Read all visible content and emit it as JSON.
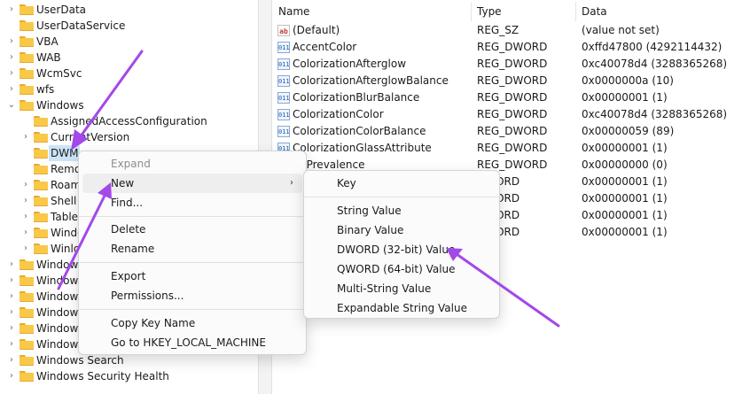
{
  "colors": {
    "accent": "#a348e9",
    "selection": "#cce4f7",
    "folder": "#f8c948"
  },
  "tree": {
    "items": [
      {
        "label": "UserData",
        "icon": "folder-icon"
      },
      {
        "label": "UserDataService",
        "icon": "folder-icon"
      },
      {
        "label": "VBA",
        "icon": "folder-icon"
      },
      {
        "label": "WAB",
        "icon": "folder-icon"
      },
      {
        "label": "WcmSvc",
        "icon": "folder-icon"
      },
      {
        "label": "wfs",
        "icon": "folder-icon"
      },
      {
        "label": "Windows",
        "icon": "folder-icon"
      },
      {
        "label": "AssignedAccessConfiguration",
        "icon": "folder-icon"
      },
      {
        "label": "CurrentVersion",
        "icon": "folder-icon"
      },
      {
        "label": "DWM",
        "icon": "folder-icon"
      },
      {
        "label": "Remo",
        "icon": "folder-icon"
      },
      {
        "label": "Roam",
        "icon": "folder-icon"
      },
      {
        "label": "Shell",
        "icon": "folder-icon"
      },
      {
        "label": "Tablet",
        "icon": "folder-icon"
      },
      {
        "label": "Windo",
        "icon": "folder-icon"
      },
      {
        "label": "Winlo",
        "icon": "folder-icon"
      },
      {
        "label": "Windows",
        "icon": "folder-icon"
      },
      {
        "label": "Windows",
        "icon": "folder-icon"
      },
      {
        "label": "Windows",
        "icon": "folder-icon"
      },
      {
        "label": "Windows",
        "icon": "folder-icon"
      },
      {
        "label": "Windows",
        "icon": "folder-icon"
      },
      {
        "label": "Windows",
        "icon": "folder-icon"
      },
      {
        "label": "Windows Search",
        "icon": "folder-icon"
      },
      {
        "label": "Windows Security Health",
        "icon": "folder-icon"
      }
    ]
  },
  "list": {
    "columns": [
      "Name",
      "Type",
      "Data"
    ],
    "rows": [
      {
        "name": "(Default)",
        "type": "REG_SZ",
        "data": "(value not set)",
        "icon": "ab"
      },
      {
        "name": "AccentColor",
        "type": "REG_DWORD",
        "data": "0xffd47800 (4292114432)",
        "icon": "011"
      },
      {
        "name": "ColorizationAfterglow",
        "type": "REG_DWORD",
        "data": "0xc40078d4 (3288365268)",
        "icon": "011"
      },
      {
        "name": "ColorizationAfterglowBalance",
        "type": "REG_DWORD",
        "data": "0x0000000a (10)",
        "icon": "011"
      },
      {
        "name": "ColorizationBlurBalance",
        "type": "REG_DWORD",
        "data": "0x00000001 (1)",
        "icon": "011"
      },
      {
        "name": "ColorizationColor",
        "type": "REG_DWORD",
        "data": "0xc40078d4 (3288365268)",
        "icon": "011"
      },
      {
        "name": "ColorizationColorBalance",
        "type": "REG_DWORD",
        "data": "0x00000059 (89)",
        "icon": "011"
      },
      {
        "name": "ColorizationGlassAttribute",
        "type": "REG_DWORD",
        "data": "0x00000001 (1)",
        "icon": "011"
      },
      {
        "name": "lorPrevalence",
        "type": "REG_DWORD",
        "data": "0x00000000 (0)",
        "icon": ""
      },
      {
        "name": "",
        "type": "DWORD",
        "data": "0x00000001 (1)",
        "icon": ""
      },
      {
        "name": "",
        "type": "DWORD",
        "data": "0x00000001 (1)",
        "icon": ""
      },
      {
        "name": "",
        "type": "DWORD",
        "data": "0x00000001 (1)",
        "icon": ""
      },
      {
        "name": "",
        "type": "DWORD",
        "data": "0x00000001 (1)",
        "icon": ""
      }
    ]
  },
  "context_menu": {
    "items": [
      "Expand",
      "New",
      "Find...",
      "Delete",
      "Rename",
      "Export",
      "Permissions...",
      "Copy Key Name",
      "Go to HKEY_LOCAL_MACHINE"
    ],
    "submenu_arrow": "›"
  },
  "submenu": {
    "items": [
      "Key",
      "String Value",
      "Binary Value",
      "DWORD (32-bit) Value",
      "QWORD (64-bit) Value",
      "Multi-String Value",
      "Expandable String Value"
    ]
  }
}
